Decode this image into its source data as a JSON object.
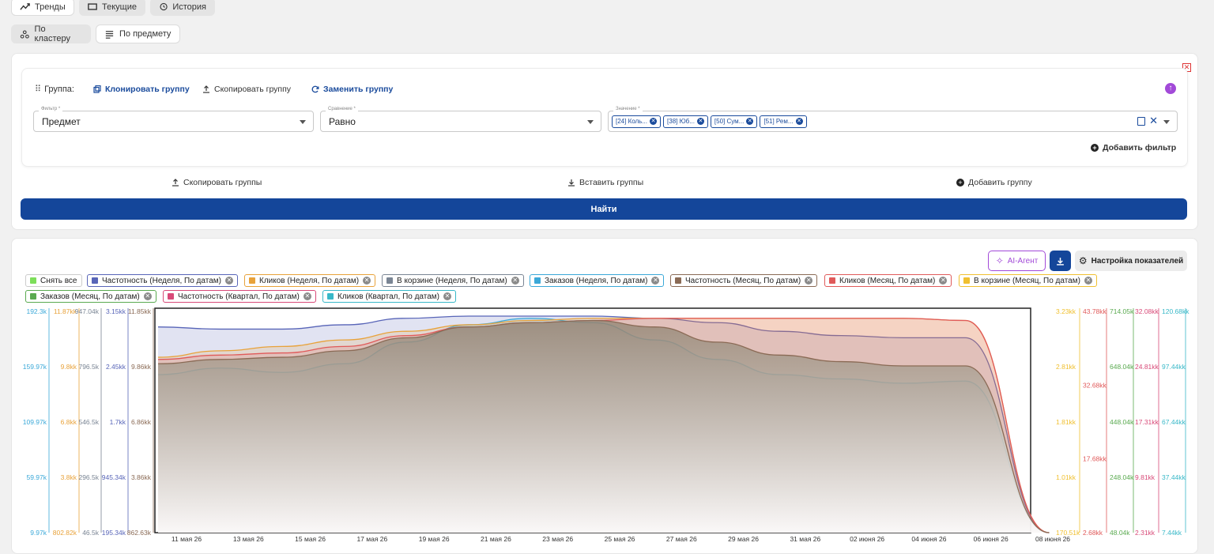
{
  "tabs": [
    {
      "label": "Тренды",
      "icon": "trend-icon",
      "active": false
    },
    {
      "label": "Текущие",
      "icon": "monitor-icon",
      "active": true
    },
    {
      "label": "История",
      "icon": "history-icon",
      "active": true
    }
  ],
  "mode_tabs": [
    {
      "label": "По кластеру",
      "icon": "cluster-icon",
      "active": true
    },
    {
      "label": "По предмету",
      "icon": "list-icon",
      "active": false
    }
  ],
  "group": {
    "label": "Группа:",
    "clone": "Клонировать группу",
    "copy": "Скопировать группу",
    "replace": "Заменить группу",
    "filter": {
      "label": "Фильтр *",
      "value": "Предмет"
    },
    "comparison": {
      "label": "Сравнение *",
      "value": "Равно"
    },
    "values": {
      "label": "Значение *",
      "chips": [
        "[24] Коль...",
        "[38] Юб...",
        "[50] Сум...",
        "[51] Рем..."
      ]
    },
    "add_filter": "Добавить фильтр"
  },
  "groups_actions": {
    "copy": "Скопировать группы",
    "paste": "Вставить группы",
    "add": "Добавить группу"
  },
  "find_button": "Найти",
  "chart_toolbar": {
    "ai_agent": "AI-Агент",
    "settings": "Настройка показателей"
  },
  "legend": [
    {
      "label": "Снять все",
      "color": "#7dde5a",
      "removable": false
    },
    {
      "label": "Частотность (Неделя, По датам)",
      "color": "#5865b8",
      "removable": true
    },
    {
      "label": "Кликов (Неделя, По датам)",
      "color": "#e8a23a",
      "removable": true
    },
    {
      "label": "В корзине (Неделя, По датам)",
      "color": "#7a8594",
      "removable": true
    },
    {
      "label": "Заказов (Неделя, По датам)",
      "color": "#3aa8d8",
      "removable": true
    },
    {
      "label": "Частотность (Месяц, По датам)",
      "color": "#8a6a55",
      "removable": true
    },
    {
      "label": "Кликов (Месяц, По датам)",
      "color": "#e05a5a",
      "removable": true
    },
    {
      "label": "В корзине (Месяц, По датам)",
      "color": "#f0c030",
      "removable": true
    },
    {
      "label": "Заказов (Месяц, По датам)",
      "color": "#5aaa50",
      "removable": true
    },
    {
      "label": "Частотность (Квартал, По датам)",
      "color": "#d84a78",
      "removable": true
    },
    {
      "label": "Кликов (Квартал, По датам)",
      "color": "#38b8c8",
      "removable": true
    }
  ],
  "chart_data": {
    "type": "area",
    "x": [
      "11 мая 26",
      "13 мая 26",
      "15 мая 26",
      "17 мая 26",
      "19 мая 26",
      "21 мая 26",
      "23 мая 26",
      "25 мая 26",
      "27 мая 26",
      "29 мая 26",
      "31 мая 26",
      "02 июня 26",
      "04 июня 26",
      "06 июня 26",
      "08 июня 26"
    ],
    "left_axes": [
      {
        "color": "#3aa8d8",
        "ticks": [
          "192.3k",
          "159.97k",
          "109.97k",
          "59.97k",
          "9.97k"
        ]
      },
      {
        "color": "#e8a23a",
        "ticks": [
          "11.87kk",
          "9.8kk",
          "6.8kk",
          "3.8kk",
          "802.82k"
        ]
      },
      {
        "color": "#7a8594",
        "ticks": [
          "947.04k",
          "796.5k",
          "546.5k",
          "296.5k",
          "46.5k"
        ]
      },
      {
        "color": "#5865b8",
        "ticks": [
          "3.15kk",
          "2.45kk",
          "1.7kk",
          "945.34k",
          "195.34k"
        ]
      },
      {
        "color": "#8a6a55",
        "ticks": [
          "11.85kk",
          "9.86kk",
          "6.86kk",
          "3.86kk",
          "862.63k"
        ]
      }
    ],
    "right_axes": [
      {
        "color": "#f0c030",
        "ticks": [
          "3.23kk",
          "2.81kk",
          "1.81kk",
          "1.01kk",
          "170.51k"
        ]
      },
      {
        "color": "#e05a5a",
        "ticks": [
          "43.78kk",
          "32.68kk",
          "17.68kk",
          "2.68kk"
        ]
      },
      {
        "color": "#5aaa50",
        "ticks": [
          "714.05k",
          "648.04k",
          "448.04k",
          "248.04k",
          "48.04k"
        ]
      },
      {
        "color": "#d84a78",
        "ticks": [
          "32.08kk",
          "24.81kk",
          "17.31kk",
          "9.81kk",
          "2.31kk"
        ]
      },
      {
        "color": "#38b8c8",
        "ticks": [
          "120.68kk",
          "97.44kk",
          "67.44kk",
          "37.44kk",
          "7.44kk"
        ]
      }
    ],
    "series": [
      {
        "color": "#5865b8",
        "values": [
          0.95,
          0.94,
          0.94,
          0.96,
          0.99,
          1.0,
          1.0,
          1.0,
          0.99,
          0.97,
          0.93,
          0.91,
          0.9,
          0.9,
          0.0
        ]
      },
      {
        "color": "#3aa8d8",
        "values": [
          0.73,
          0.76,
          0.74,
          0.78,
          0.88,
          0.96,
          0.99,
          0.97,
          0.89,
          0.8,
          0.73,
          0.71,
          0.69,
          0.7,
          0.0
        ]
      },
      {
        "color": "#e8a23a",
        "values": [
          0.81,
          0.84,
          0.86,
          0.89,
          0.93,
          0.96,
          0.98,
          0.99,
          0.99,
          0.99,
          0.99,
          0.99,
          0.99,
          0.98,
          0.0
        ]
      },
      {
        "color": "#e05a5a",
        "values": [
          0.8,
          0.82,
          0.83,
          0.86,
          0.91,
          0.95,
          0.97,
          0.98,
          0.99,
          0.99,
          0.99,
          0.99,
          0.99,
          0.98,
          0.0
        ]
      },
      {
        "color": "#8a6a55",
        "values": [
          0.78,
          0.8,
          0.81,
          0.84,
          0.9,
          0.95,
          0.97,
          0.98,
          0.95,
          0.88,
          0.82,
          0.79,
          0.77,
          0.77,
          0.0
        ]
      }
    ]
  }
}
